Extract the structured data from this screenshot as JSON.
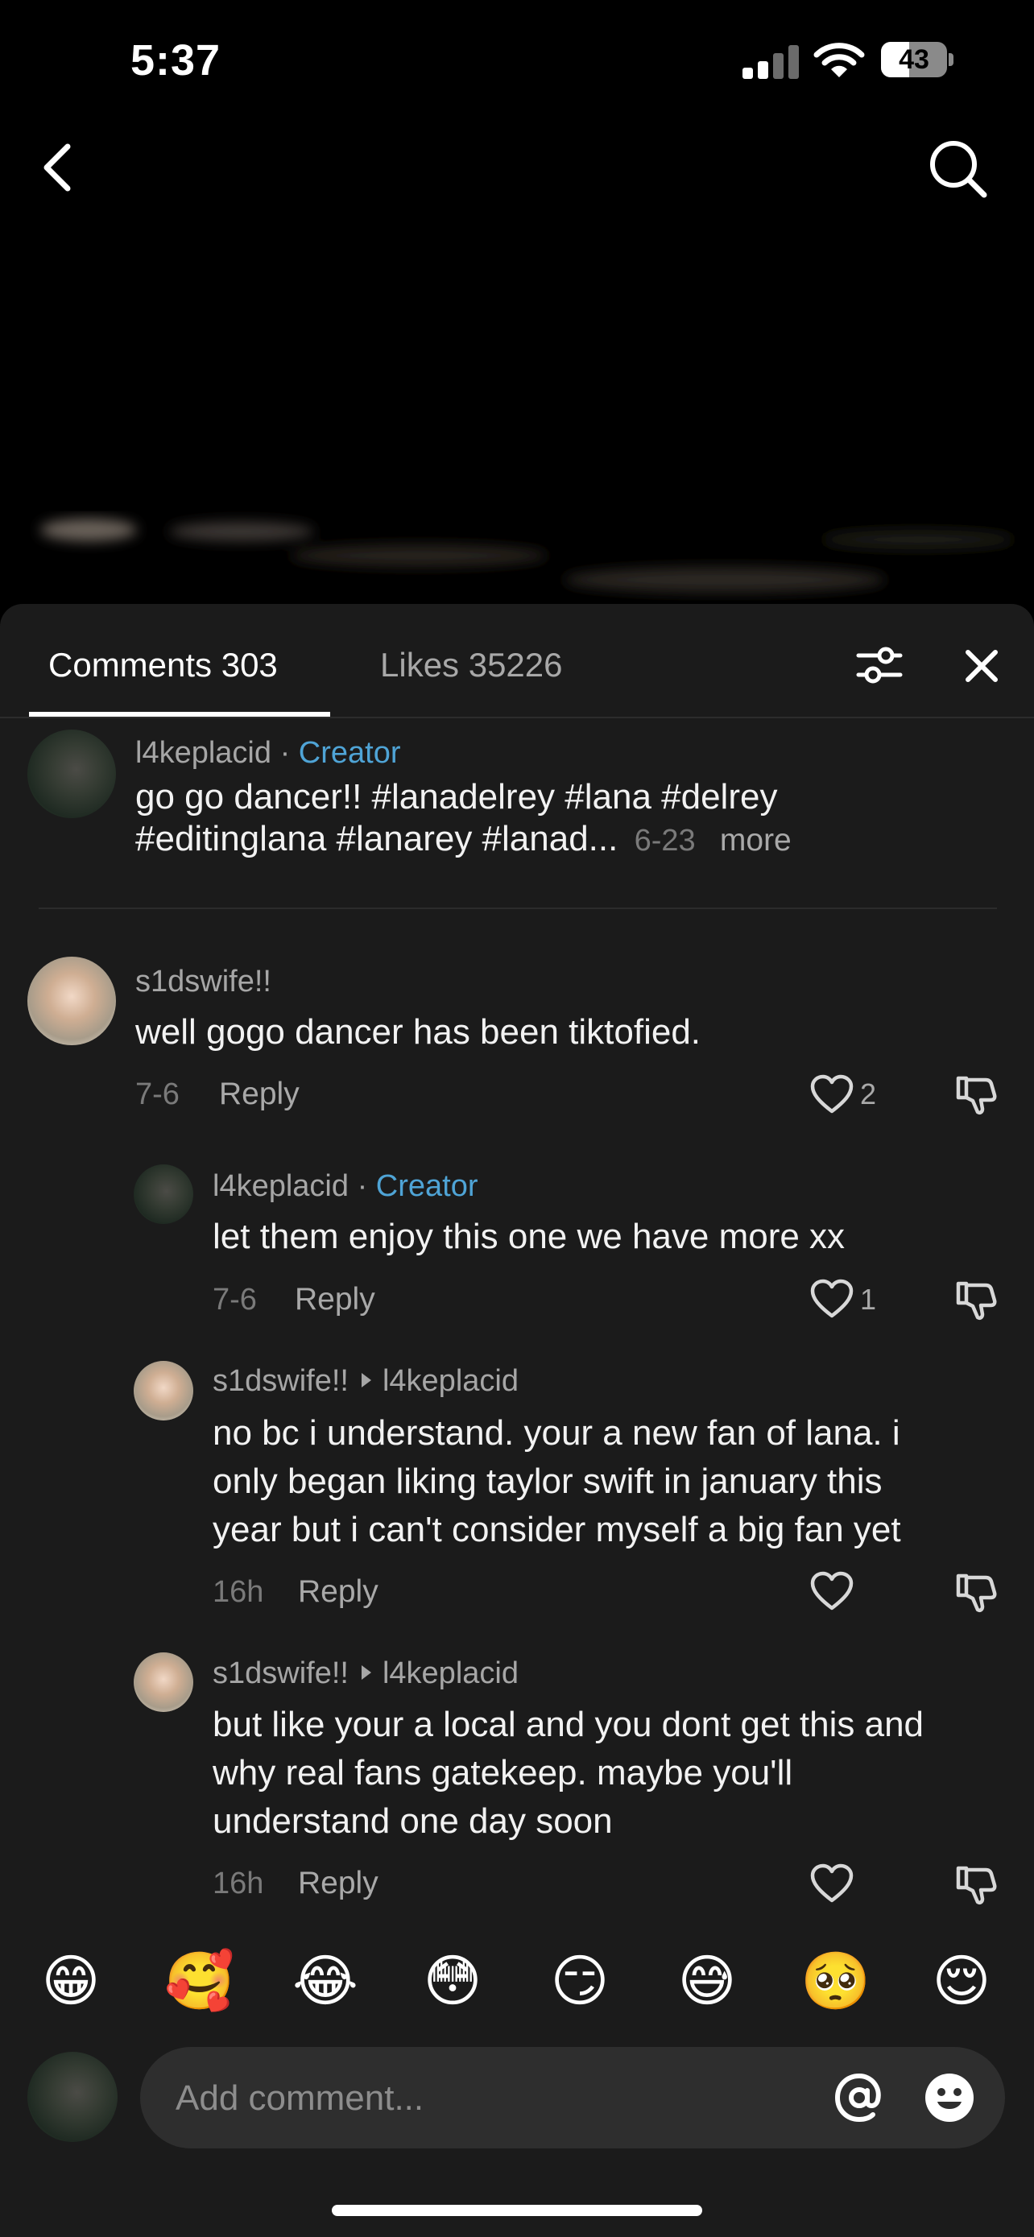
{
  "status_bar": {
    "time": "5:37",
    "battery": "43",
    "battery_level": 0.43
  },
  "tabs": {
    "comments": "Comments 303",
    "likes": "Likes 35226"
  },
  "caption": {
    "user": "l4keplacid",
    "separator": "·",
    "badge": "Creator",
    "text_line1": "go go dancer!! #lanadelrey #lana #delrey",
    "text_line2": "#editinglana #lanarey #lanad...",
    "date": "6-23",
    "more": "more"
  },
  "comments": [
    {
      "user": "s1dswife!!",
      "text": "well gogo dancer has been tiktofied.",
      "date": "7-6",
      "reply": "Reply",
      "likes": "2"
    },
    {
      "user": "l4keplacid",
      "separator": "·",
      "badge": "Creator",
      "text": "let them enjoy this one we have more xx",
      "date": "7-6",
      "reply": "Reply",
      "likes": "1"
    },
    {
      "user": "s1dswife!!",
      "reply_to": "l4keplacid",
      "text_lines": [
        "no bc i understand. your a new fan of lana. i",
        "only began liking taylor swift in january this",
        "year but i can't consider myself a big fan yet"
      ],
      "date": "16h",
      "reply": "Reply"
    },
    {
      "user": "s1dswife!!",
      "reply_to": "l4keplacid",
      "text_lines": [
        "but like your a local and you dont get this and",
        "why real fans gatekeep. maybe you'll",
        "understand one day soon"
      ],
      "date": "16h",
      "reply": "Reply"
    }
  ],
  "emojis": [
    "😁",
    "🥰",
    "😂",
    "😳",
    "😏",
    "😅",
    "🥺",
    "😌"
  ],
  "composer": {
    "placeholder": "Add comment..."
  },
  "icons": [
    "back-arrow-icon",
    "search-icon",
    "filter-icon",
    "close-icon",
    "heart-icon",
    "dislike-icon",
    "at-icon",
    "emoji-icon"
  ],
  "colors": {
    "creator_badge": "#4fa4d6",
    "panel_bg": "#1b1b1b",
    "screen_bg": "#000000"
  }
}
